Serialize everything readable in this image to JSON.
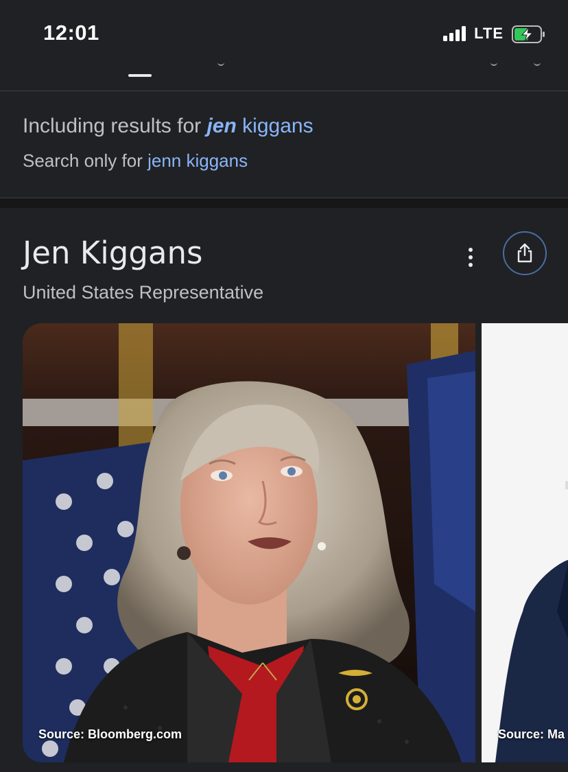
{
  "status": {
    "time": "12:01",
    "network": "LTE"
  },
  "correction": {
    "prefix": "Including results for ",
    "corrected_word": "jen",
    "rest": " kiggans",
    "search_only_prefix": "Search only for ",
    "original_query": "jenn kiggans"
  },
  "knowledge_panel": {
    "title": "Jen Kiggans",
    "subtitle": "United States Representative",
    "images": [
      {
        "source": "Source: Bloomberg.com"
      },
      {
        "source": "Source: Ma"
      }
    ]
  },
  "colors": {
    "link": "#8ab4f8",
    "background": "#202124",
    "battery": "#34c759"
  },
  "icons": [
    "signal-icon",
    "battery-charging-icon",
    "more-vert-icon",
    "share-icon"
  ]
}
